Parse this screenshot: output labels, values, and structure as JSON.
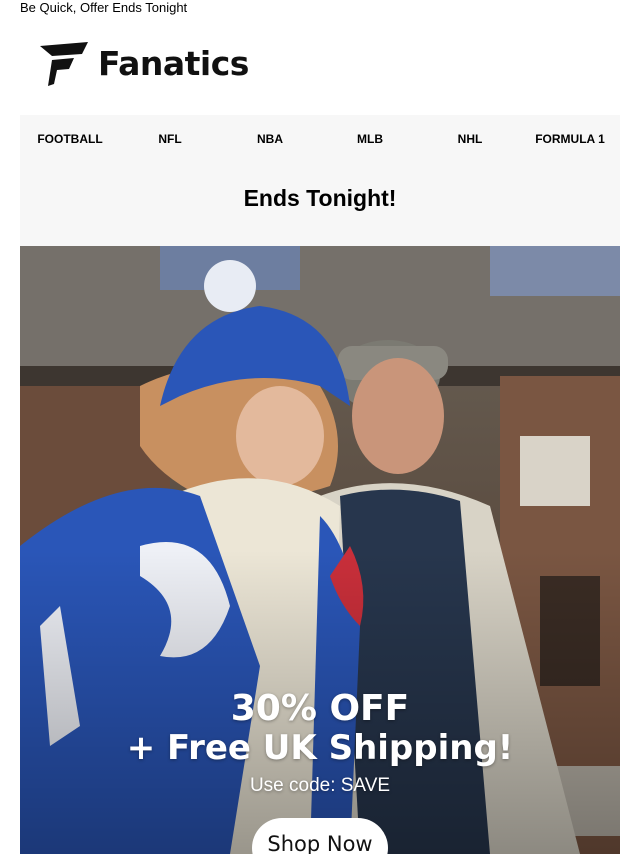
{
  "preheader": "Be Quick, Offer Ends Tonight",
  "brand": {
    "name": "Fanatics",
    "icon": "fanatics-flag-icon"
  },
  "nav": [
    {
      "label": "FOOTBALL"
    },
    {
      "label": "NFL"
    },
    {
      "label": "NBA"
    },
    {
      "label": "MLB"
    },
    {
      "label": "NHL"
    },
    {
      "label": "FORMULA 1"
    }
  ],
  "headline": "Ends Tonight!",
  "hero": {
    "offer_line1": "30% OFF",
    "offer_line2": "+ Free UK Shipping!",
    "code_text": "Use code: SAVE",
    "cta_label": "Shop Now"
  },
  "colors": {
    "colts_blue": "#2a56b8",
    "panel_bg": "#f7f7f7",
    "text": "#000000"
  }
}
